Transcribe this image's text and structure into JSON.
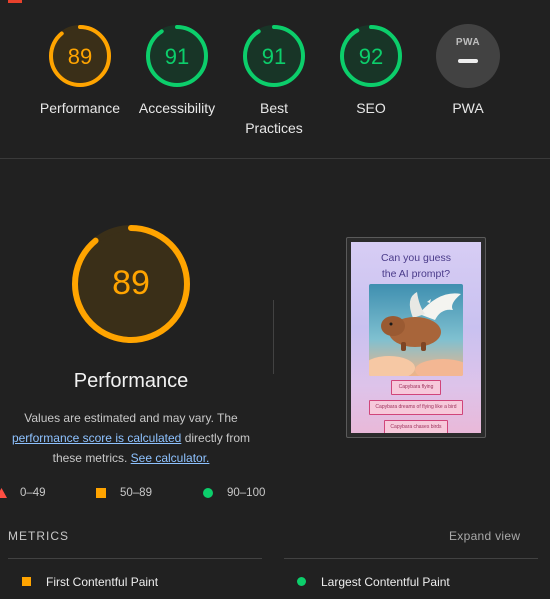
{
  "colors": {
    "average": "#ffa400",
    "pass": "#0cce6b",
    "fail": "#ff4e42",
    "link": "#8ec2ff"
  },
  "categories": [
    {
      "id": "performance",
      "score": 89,
      "label": "Performance",
      "status": "average"
    },
    {
      "id": "accessibility",
      "score": 91,
      "label": "Accessibility",
      "status": "pass"
    },
    {
      "id": "best-practices",
      "score": 91,
      "label": "Best Practices",
      "status": "pass"
    },
    {
      "id": "seo",
      "score": 92,
      "label": "SEO",
      "status": "pass"
    },
    {
      "id": "pwa",
      "badge": "PWA",
      "label": "PWA",
      "status": "na"
    }
  ],
  "main": {
    "score": 89,
    "title": "Performance",
    "desc_line1": "Values are estimated and may vary. The",
    "desc_link1": "performance score is calculated",
    "desc_mid": " directly from",
    "desc_line3": "these metrics. ",
    "desc_link2": "See calculator."
  },
  "screenshot": {
    "title_line1": "Can you guess",
    "title_line2": "the AI prompt?",
    "art_icon": "flying-capybara-illustration",
    "buttons": [
      "Capybara flying",
      "Capybara dreams of flying like a bird",
      "Capybara chases birds"
    ]
  },
  "legend": [
    {
      "shape": "triangle",
      "range": "0–49"
    },
    {
      "shape": "square",
      "range": "50–89"
    },
    {
      "shape": "circle",
      "range": "90–100"
    }
  ],
  "metrics": {
    "heading": "METRICS",
    "expand_label": "Expand view",
    "items": [
      {
        "label": "First Contentful Paint",
        "status": "average"
      },
      {
        "label": "Largest Contentful Paint",
        "status": "pass"
      }
    ]
  }
}
